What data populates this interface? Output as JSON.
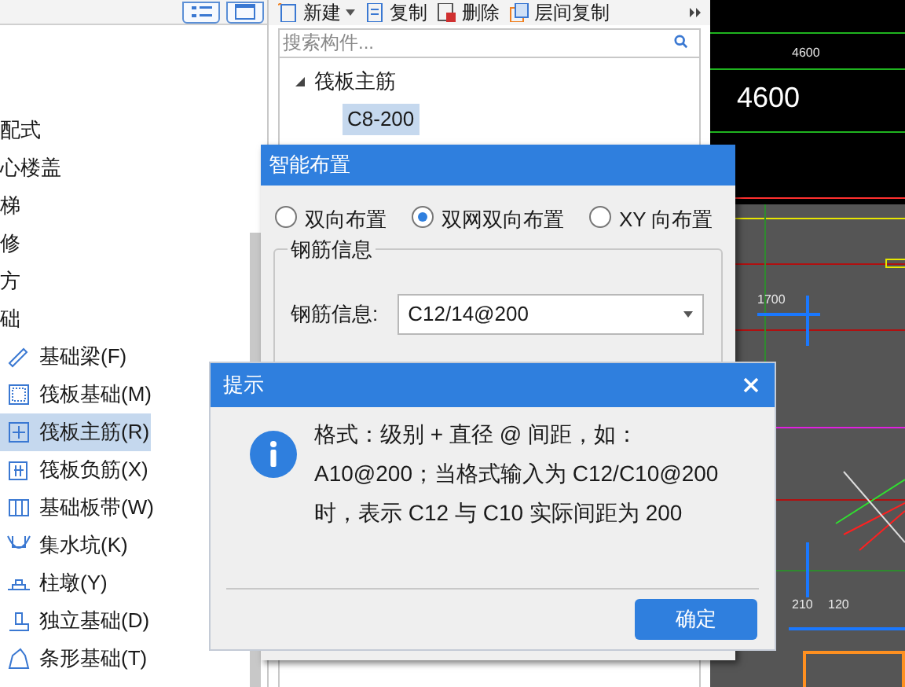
{
  "left_panel": {
    "tree": [
      {
        "label": "配式"
      },
      {
        "label": "心楼盖"
      },
      {
        "label": "梯"
      },
      {
        "label": "修"
      },
      {
        "label": "方"
      },
      {
        "label": "础",
        "children": [
          {
            "label": "基础梁(F)",
            "selected": false
          },
          {
            "label": "筏板基础(M)",
            "selected": false
          },
          {
            "label": "筏板主筋(R)",
            "selected": true
          },
          {
            "label": "筏板负筋(X)",
            "selected": false
          },
          {
            "label": "基础板带(W)",
            "selected": false
          },
          {
            "label": "集水坑(K)",
            "selected": false
          },
          {
            "label": "柱墩(Y)",
            "selected": false
          },
          {
            "label": "独立基础(D)",
            "selected": false
          },
          {
            "label": "条形基础(T)",
            "selected": false
          }
        ]
      }
    ]
  },
  "component_panel": {
    "toolbar": [
      {
        "label": "新建",
        "kind": "dropdown"
      },
      {
        "label": "复制",
        "kind": "copy"
      },
      {
        "label": "删除",
        "kind": "delete"
      },
      {
        "label": "层间复制",
        "kind": "floor-copy"
      }
    ],
    "search": {
      "placeholder": "搜索构件..."
    },
    "tree": [
      {
        "label": "筏板主筋",
        "expanded": true,
        "children": [
          {
            "label": "C8-200",
            "selected": true
          }
        ]
      }
    ]
  },
  "drawing_labels": [
    {
      "text": "4600",
      "kind": "small"
    },
    {
      "text": "4600",
      "kind": "large"
    },
    {
      "text": "1700",
      "kind": "small"
    },
    {
      "text": "210",
      "kind": "small"
    },
    {
      "text": "120",
      "kind": "small"
    }
  ],
  "layout_dialog": {
    "title": "智能布置",
    "options": [
      {
        "label": "双向布置",
        "selected": false
      },
      {
        "label": "双网双向布置",
        "selected": true
      },
      {
        "label": "XY 向布置",
        "selected": false
      }
    ],
    "group_title": "钢筋信息",
    "field_label": "钢筋信息:",
    "field_value": "C12/14@200"
  },
  "hint_dialog": {
    "title": "提示",
    "message": "格式：级别 + 直径 @ 间距，如：A10@200；当格式输入为 C12/C10@200时，表示 C12 与 C10 实际间距为 200",
    "button": "确定"
  }
}
